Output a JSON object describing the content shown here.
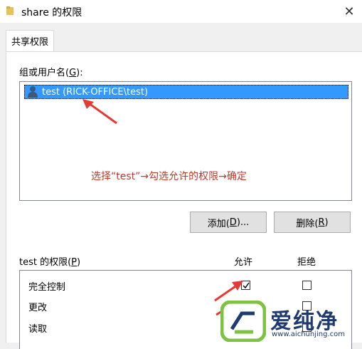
{
  "window": {
    "title": "share 的权限"
  },
  "tabs": [
    {
      "label": "共享权限"
    }
  ],
  "group_label": {
    "text": "组或用户名(",
    "accel": "G",
    "suffix": "):"
  },
  "users": [
    {
      "name": "test (RICK-OFFICE\\test)",
      "selected": true
    }
  ],
  "annotation": "选择“test”→勾选允许的权限→确定",
  "buttons": {
    "add": {
      "text": "添加(",
      "accel": "D",
      "suffix": ")..."
    },
    "remove": {
      "text": "删除(",
      "accel": "R",
      "suffix": ")"
    }
  },
  "permissions": {
    "label": {
      "text": "test 的权限(",
      "accel": "P",
      "suffix": ")"
    },
    "allow_header": "允许",
    "deny_header": "拒绝",
    "rows": [
      {
        "name": "完全控制",
        "allow": true,
        "deny": false
      },
      {
        "name": "更改",
        "allow": true,
        "deny": false
      },
      {
        "name": "读取",
        "allow": true,
        "deny": false
      }
    ]
  },
  "colors": {
    "selection": "#3399ff",
    "annotation": "#c0392b",
    "arrow": "#e53935",
    "watermark_green": "#7dc242",
    "watermark_blue": "#1f3a6e"
  },
  "watermark": {
    "brand": "爱纯净",
    "url": "www.aichunjing.com"
  }
}
